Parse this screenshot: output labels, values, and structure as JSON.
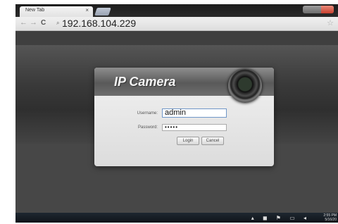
{
  "browser": {
    "tab_title": "New Tab",
    "tab_close": "×",
    "back_icon": "←",
    "forward_icon": "→",
    "reload_icon": "C",
    "search_icon": "⌕",
    "url": "192.168.104.229",
    "star_icon": "☆"
  },
  "login": {
    "brand": "IP Camera",
    "username_label": "Username:",
    "username_value": "admin",
    "password_label": "Password:",
    "password_value": "•••••",
    "login_button": "Login",
    "cancel_button": "Cancel"
  },
  "taskbar": {
    "tray_icons": "▴ ◼ ⚑ ▭ ◂",
    "clock_line1": "2:55 PM",
    "clock_line2": "5/16/20"
  }
}
